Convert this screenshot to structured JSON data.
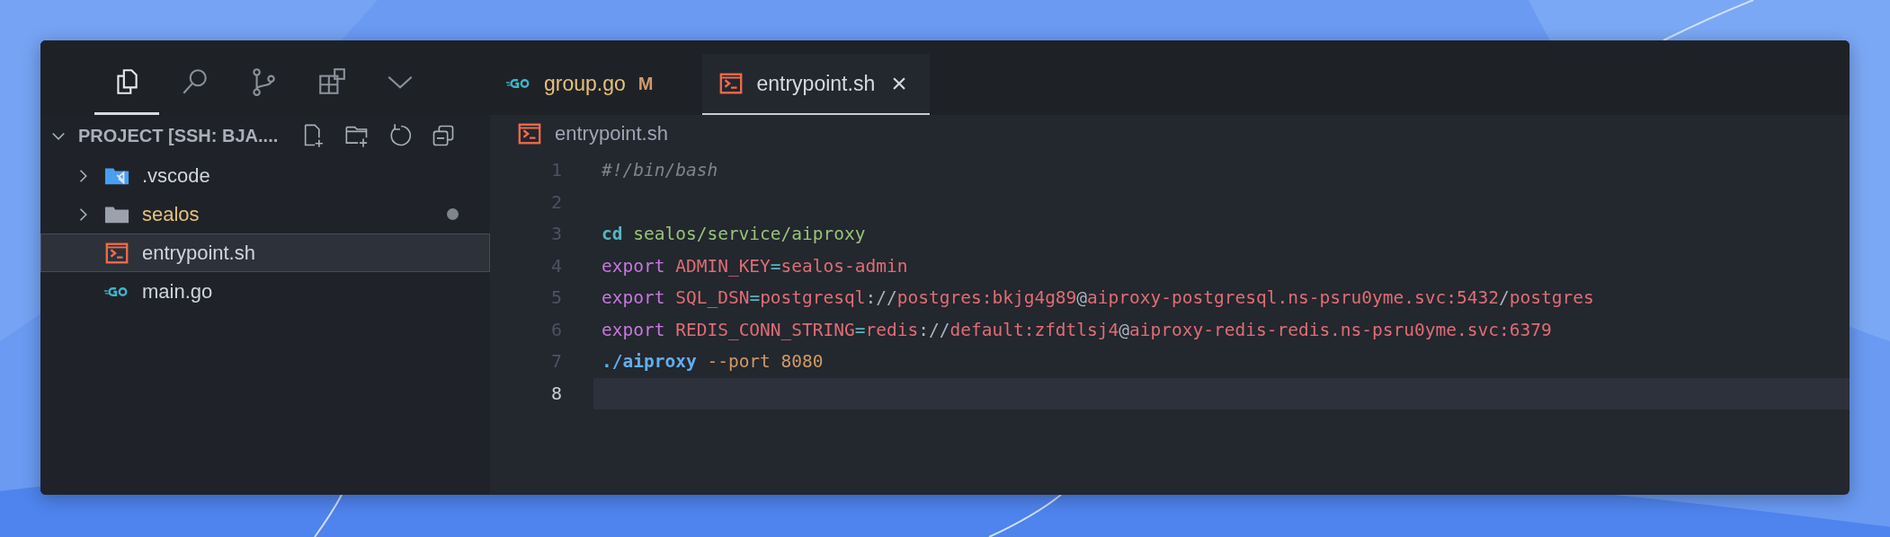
{
  "activity_bar": [
    {
      "kind": "files",
      "selected": true
    },
    {
      "kind": "search",
      "selected": false
    },
    {
      "kind": "source-control",
      "selected": false
    },
    {
      "kind": "extensions",
      "selected": false
    },
    {
      "kind": "chevron",
      "selected": false
    }
  ],
  "tabs": [
    {
      "label": "group.go",
      "kind": "go",
      "badge": "M",
      "modified": true,
      "selected": false
    },
    {
      "label": "entrypoint.sh",
      "kind": "shell",
      "close": "×",
      "modified": false,
      "selected": true
    }
  ],
  "explorer": {
    "title": "PROJECT [SSH: BJA....",
    "expanded": true,
    "items": [
      {
        "label": ".vscode",
        "kind": "vscode-folder",
        "expanded": false,
        "modified": false,
        "selected": false
      },
      {
        "label": "sealos",
        "kind": "folder",
        "expanded": false,
        "modified": true,
        "selected": false
      },
      {
        "label": "entrypoint.sh",
        "kind": "shell",
        "modified": false,
        "selected": true
      },
      {
        "label": "main.go",
        "kind": "go",
        "modified": false,
        "selected": false
      }
    ]
  },
  "breadcrumb": {
    "label": "entrypoint.sh",
    "kind": "shell"
  },
  "code_lines": [
    {
      "number": "1",
      "current": false,
      "tokens": [
        {
          "text": "#!/bin/bash",
          "kind": "comment"
        }
      ]
    },
    {
      "number": "2",
      "current": false
    },
    {
      "number": "3",
      "current": false,
      "tokens": [
        {
          "text": "cd",
          "kind": "builtin"
        },
        {
          "text": " sealos/service/aiproxy",
          "kind": "string"
        }
      ]
    },
    {
      "number": "4",
      "current": false,
      "tokens": [
        {
          "text": "export",
          "kind": "keyword"
        },
        {
          "text": " ADMIN_KEY",
          "kind": "variable"
        },
        {
          "text": "=",
          "kind": "operator"
        },
        {
          "text": "sealos-admin",
          "kind": "variable"
        }
      ]
    },
    {
      "number": "5",
      "current": false,
      "tokens": [
        {
          "text": "export",
          "kind": "keyword"
        },
        {
          "text": " SQL_DSN",
          "kind": "variable"
        },
        {
          "text": "=",
          "kind": "operator"
        },
        {
          "text": "postgresql",
          "kind": "variable"
        },
        {
          "text": "://",
          "kind": "punct"
        },
        {
          "text": "postgres:bkjg4g89",
          "kind": "variable"
        },
        {
          "text": "@",
          "kind": "punct"
        },
        {
          "text": "aiproxy-postgresql.ns-psru0yme.svc:5432",
          "kind": "variable"
        },
        {
          "text": "/",
          "kind": "punct"
        },
        {
          "text": "postgres",
          "kind": "variable"
        }
      ]
    },
    {
      "number": "6",
      "current": false,
      "tokens": [
        {
          "text": "export",
          "kind": "keyword"
        },
        {
          "text": " REDIS_CONN_STRING",
          "kind": "variable"
        },
        {
          "text": "=",
          "kind": "operator"
        },
        {
          "text": "redis",
          "kind": "variable"
        },
        {
          "text": "://",
          "kind": "punct"
        },
        {
          "text": "default:zfdtlsj4",
          "kind": "variable"
        },
        {
          "text": "@",
          "kind": "punct"
        },
        {
          "text": "aiproxy-redis-redis.ns-psru0yme.svc:6379",
          "kind": "variable"
        }
      ]
    },
    {
      "number": "7",
      "current": false,
      "tokens": [
        {
          "text": "./aiproxy",
          "kind": "command"
        },
        {
          "text": " --port",
          "kind": "flag"
        },
        {
          "text": " 8080",
          "kind": "number"
        }
      ]
    },
    {
      "number": "8",
      "current": true
    }
  ]
}
